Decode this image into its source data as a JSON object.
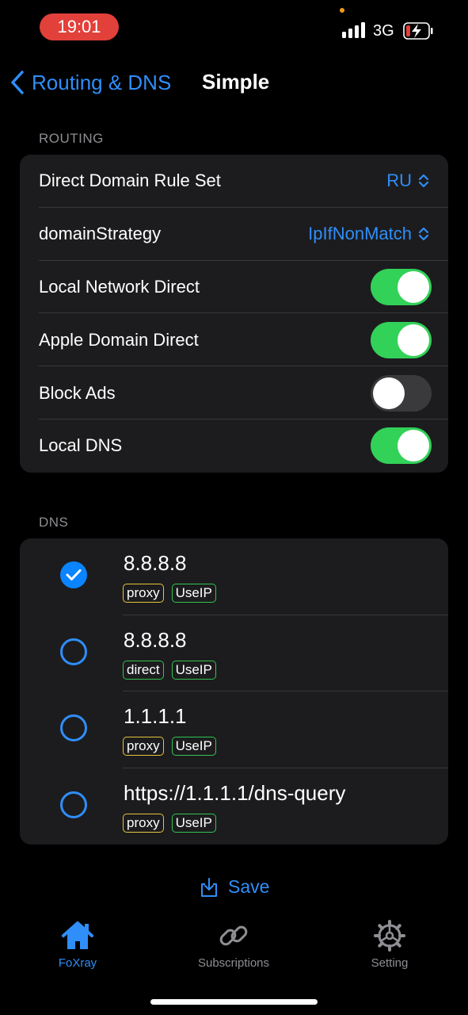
{
  "status": {
    "time": "19:01",
    "network": "3G"
  },
  "nav": {
    "back_label": "Routing & DNS",
    "title": "Simple"
  },
  "routing": {
    "section_label": "ROUTING",
    "rows": [
      {
        "label": "Direct Domain Rule Set",
        "type": "picker",
        "value": "RU"
      },
      {
        "label": "domainStrategy",
        "type": "picker",
        "value": "IpIfNonMatch"
      },
      {
        "label": "Local Network Direct",
        "type": "toggle",
        "on": true
      },
      {
        "label": "Apple Domain Direct",
        "type": "toggle",
        "on": true
      },
      {
        "label": "Block Ads",
        "type": "toggle",
        "on": false
      },
      {
        "label": "Local DNS",
        "type": "toggle",
        "on": true
      }
    ]
  },
  "dns": {
    "section_label": "DNS",
    "servers": [
      {
        "address": "8.8.8.8",
        "selected": true,
        "tags": [
          {
            "text": "proxy",
            "color": "#e5c53a"
          },
          {
            "text": "UseIP",
            "color": "#31c452"
          }
        ]
      },
      {
        "address": "8.8.8.8",
        "selected": false,
        "tags": [
          {
            "text": "direct",
            "color": "#31c452"
          },
          {
            "text": "UseIP",
            "color": "#31c452"
          }
        ]
      },
      {
        "address": "1.1.1.1",
        "selected": false,
        "tags": [
          {
            "text": "proxy",
            "color": "#e5c53a"
          },
          {
            "text": "UseIP",
            "color": "#31c452"
          }
        ]
      },
      {
        "address": "https://1.1.1.1/dns-query",
        "selected": false,
        "tags": [
          {
            "text": "proxy",
            "color": "#e5c53a"
          },
          {
            "text": "UseIP",
            "color": "#31c452"
          }
        ]
      }
    ]
  },
  "save_label": "Save",
  "tabs": [
    {
      "label": "FoXray",
      "icon": "house-icon",
      "active": true
    },
    {
      "label": "Subscriptions",
      "icon": "link-icon",
      "active": false
    },
    {
      "label": "Setting",
      "icon": "gear-icon",
      "active": false
    }
  ],
  "colors": {
    "accent": "#2f8ef9",
    "toggle_on": "#32d158",
    "time_pill": "#e2403a"
  }
}
